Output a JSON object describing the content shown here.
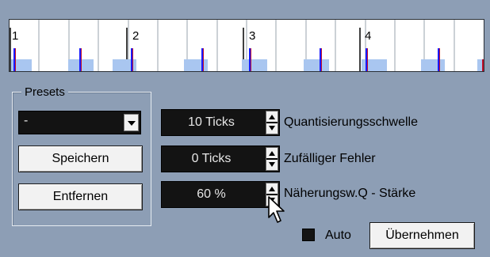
{
  "grid": {
    "bar_labels": [
      "1",
      "2",
      "3",
      "4"
    ],
    "colors": {
      "background": "#ffffff",
      "line": "#9aa3ad",
      "bar": "#000000",
      "note": "#a9c6f0",
      "marker_blue": "#1a1aff",
      "marker_red": "#c0102a"
    }
  },
  "presets": {
    "legend": "Presets",
    "selected": "-",
    "save_label": "Speichern",
    "remove_label": "Entfernen"
  },
  "settings": {
    "threshold": {
      "value": "10 Ticks",
      "label": "Quantisierungsschwelle"
    },
    "random": {
      "value": "0 Ticks",
      "label": "Zufälliger Fehler"
    },
    "strength": {
      "value": "60 %",
      "label": "Näherungsw.Q - Stärke"
    }
  },
  "footer": {
    "auto_label": "Auto",
    "auto_checked": false,
    "apply_label": "Übernehmen"
  },
  "icons": [
    "chevron-down-icon",
    "spin-up-icon",
    "spin-down-icon",
    "mouse-pointer-icon"
  ]
}
